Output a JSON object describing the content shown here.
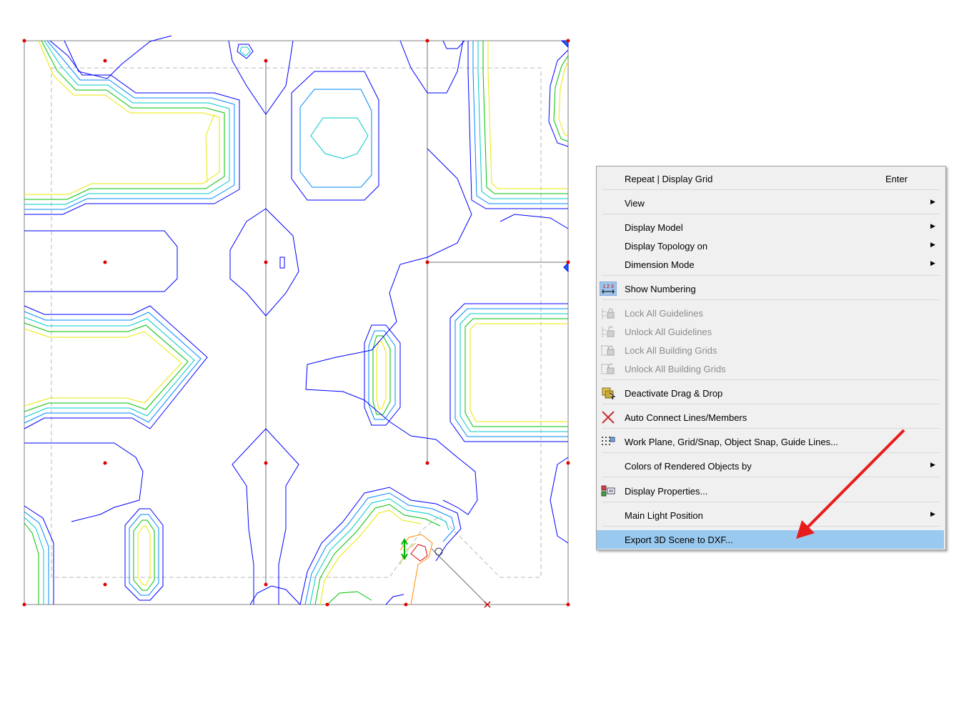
{
  "menu": {
    "items": [
      {
        "label": "Repeat | Display Grid",
        "shortcut": "Enter",
        "icon": "",
        "enabled": true
      },
      {
        "label": "View",
        "submenu": true,
        "icon": "",
        "enabled": true
      },
      {
        "label": "Display Model",
        "submenu": true,
        "icon": "",
        "enabled": true
      },
      {
        "label": "Display Topology on",
        "submenu": true,
        "icon": "",
        "enabled": true
      },
      {
        "label": "Dimension Mode",
        "submenu": true,
        "icon": "",
        "enabled": true
      },
      {
        "label": "Show Numbering",
        "icon": "numbering-icon",
        "enabled": true
      },
      {
        "label": "Lock All Guidelines",
        "icon": "lock-guidelines-icon",
        "enabled": false
      },
      {
        "label": "Unlock All Guidelines",
        "icon": "unlock-guidelines-icon",
        "enabled": false
      },
      {
        "label": "Lock All Building Grids",
        "icon": "lock-building-grids-icon",
        "enabled": false
      },
      {
        "label": "Unlock All Building Grids",
        "icon": "unlock-building-grids-icon",
        "enabled": false
      },
      {
        "label": "Deactivate Drag & Drop",
        "icon": "drag-drop-icon",
        "enabled": true
      },
      {
        "label": "Auto Connect Lines/Members",
        "icon": "auto-connect-icon",
        "enabled": true
      },
      {
        "label": "Work Plane, Grid/Snap, Object Snap, Guide Lines...",
        "icon": "work-plane-grid-icon",
        "enabled": true
      },
      {
        "label": "Colors of Rendered Objects by",
        "submenu": true,
        "icon": "",
        "enabled": true
      },
      {
        "label": "Display Properties...",
        "icon": "display-properties-icon",
        "enabled": true
      },
      {
        "label": "Main Light Position",
        "submenu": true,
        "icon": "",
        "enabled": true
      },
      {
        "label": "Export 3D Scene to DXF...",
        "icon": "",
        "enabled": true,
        "highlighted": true
      }
    ],
    "numbering_icon_text": "1 2 3",
    "submenu_glyph": "▶"
  },
  "colors": {
    "highlight": "#99c9ef",
    "arrow": "#e81c1c",
    "contour_blue": "#0000ff",
    "contour_green": "#00c000",
    "contour_cyan": "#00c8c8",
    "contour_yellow": "#e8e800",
    "node_red": "#e00000"
  }
}
